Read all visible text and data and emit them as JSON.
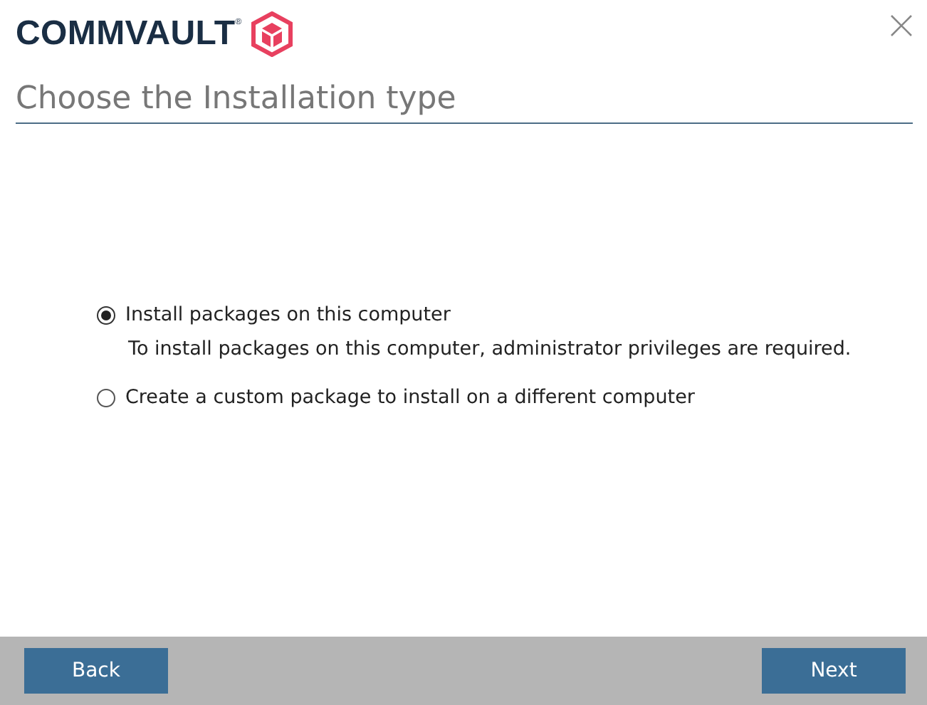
{
  "logo": {
    "text": "COMMVAULT$^{®}$"
  },
  "title": "Choose the Installation type",
  "options": [
    {
      "label": "Install packages on this computer",
      "description": "To install packages on this computer, administrator privileges are required.",
      "selected": true
    },
    {
      "label": "Create a custom package to install on a different computer",
      "selected": false
    }
  ],
  "buttons": [
    "Back",
    "Next"
  ]
}
